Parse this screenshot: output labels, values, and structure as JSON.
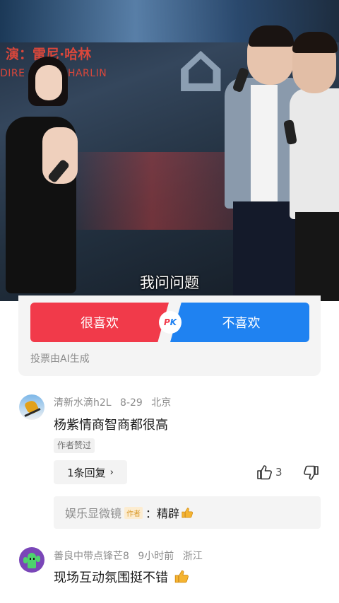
{
  "video": {
    "subtitle": "我问问题",
    "poster_credit": "演：雷尼·哈林",
    "poster_credit_en": "DIRE  RENNY HARLIN"
  },
  "vote": {
    "like_label": "很喜欢",
    "dislike_label": "不喜欢",
    "pk_p": "P",
    "pk_k": "K",
    "note": "投票由AI生成",
    "colors": {
      "like": "#f13a4a",
      "dislike": "#1f82f1"
    }
  },
  "comments": [
    {
      "user": "清新水滴h2L",
      "date": "8-29",
      "location": "北京",
      "text": "杨紫情商智商都很高",
      "author_liked": "作者赞过",
      "replies_label": "1条回复",
      "replies_chevron": "›",
      "likes": "3",
      "reply_preview": {
        "name": "娱乐显微镜",
        "tag": "作者",
        "text": "：精辟"
      }
    },
    {
      "user": "善良中带点锋芒8",
      "date": "9小时前",
      "location": "浙江",
      "text": "现场互动氛围挺不错"
    }
  ]
}
